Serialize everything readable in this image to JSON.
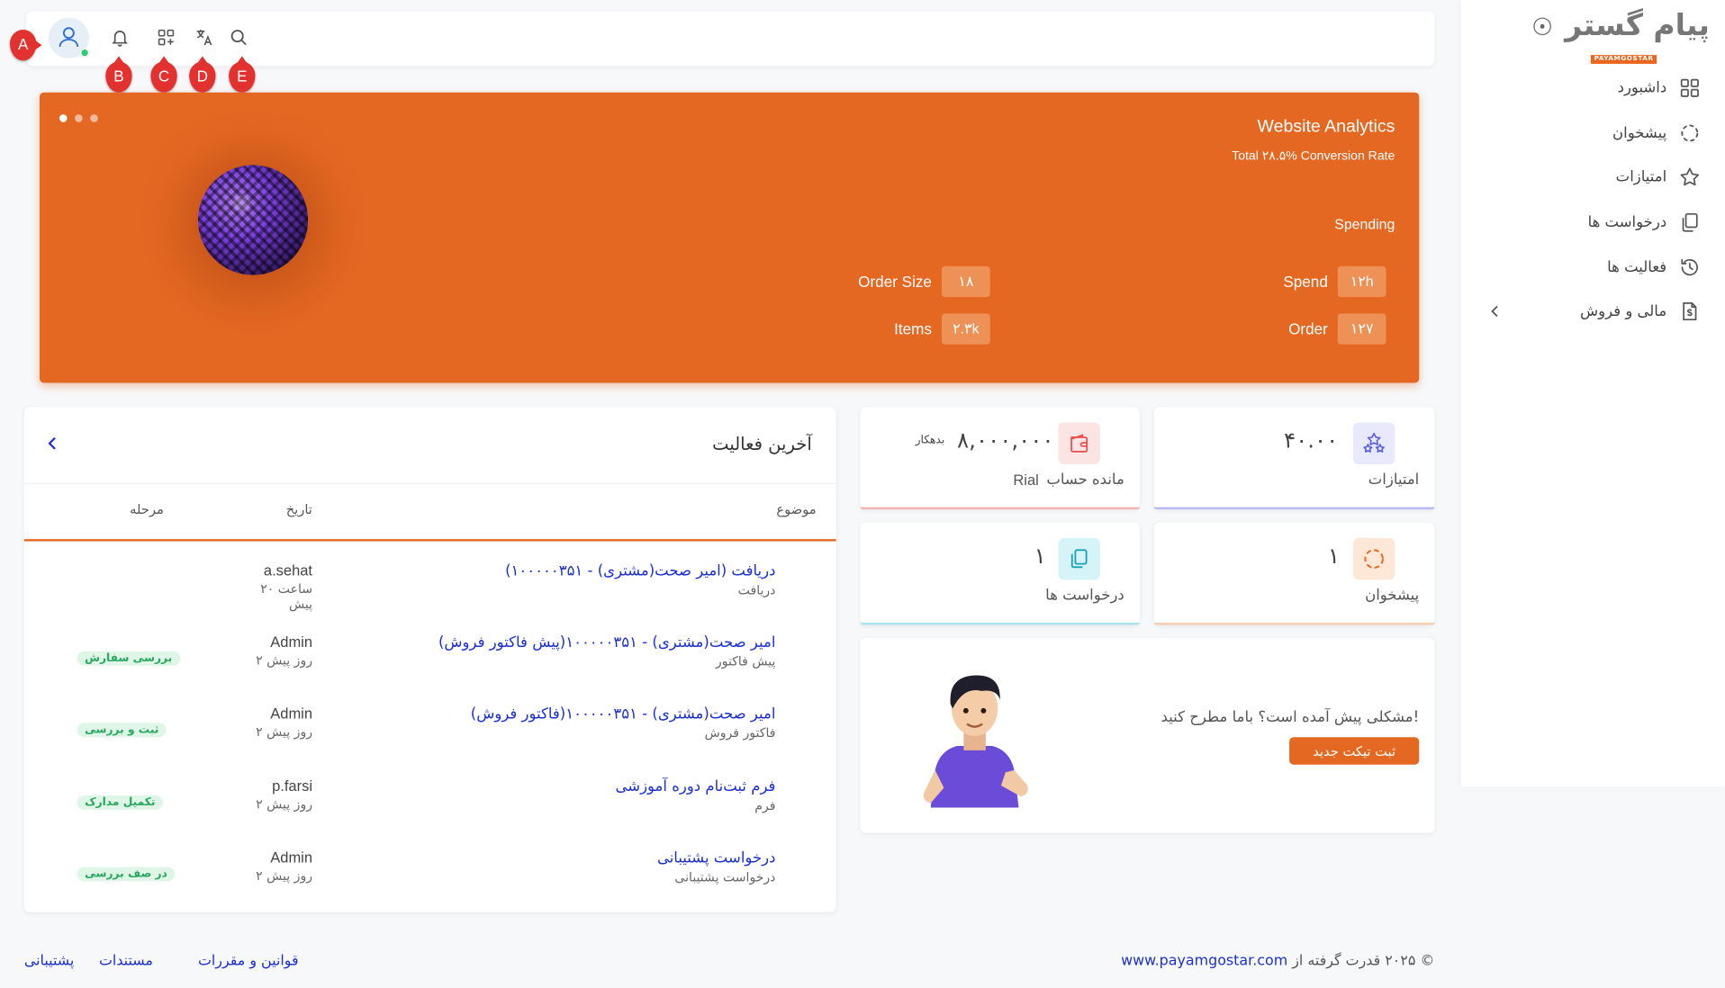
{
  "sidebar": {
    "brand": "پیام گستر",
    "brand_sub": "PAYAMGOSTAR",
    "items": [
      {
        "label": "داشبورد",
        "icon": "grid-icon"
      },
      {
        "label": "پیشخوان",
        "icon": "dashed-circle-icon"
      },
      {
        "label": "امتیازات",
        "icon": "star-icon"
      },
      {
        "label": "درخواست ها",
        "icon": "copy-icon"
      },
      {
        "label": "فعالیت ها",
        "icon": "history-icon"
      },
      {
        "label": "مالی و فروش",
        "icon": "invoice-icon"
      }
    ]
  },
  "topbar": {
    "markers": [
      "A",
      "B",
      "C",
      "D",
      "E"
    ],
    "icons": [
      "user-icon",
      "bell-icon",
      "apps-icon",
      "translate-icon",
      "search-icon"
    ]
  },
  "banner": {
    "title": "Website Analytics",
    "subtitle": "Total ۲۸.۵% Conversion Rate",
    "section": "Spending",
    "stats": [
      {
        "label": "Spend",
        "value": "۱۲h"
      },
      {
        "label": "Order",
        "value": "۱۲۷"
      },
      {
        "label": "Order Size",
        "value": "۱۸"
      },
      {
        "label": "Items",
        "value": "۲.۳k"
      }
    ]
  },
  "cards": {
    "points": {
      "value": "۴۰.۰۰",
      "label": "امتیازات"
    },
    "balance": {
      "value": "۸,۰۰۰,۰۰۰",
      "tag": "بدهکار",
      "label": "مانده حساب",
      "unit": "Rial"
    },
    "counter": {
      "value": "۱",
      "label": "پیشخوان"
    },
    "requests": {
      "value": "۱",
      "label": "درخواست ها"
    }
  },
  "help": {
    "text": "مشکلی پیش آمده است؟ باما مطرح کنید!",
    "button": "ثبت تیکت جدید"
  },
  "activity": {
    "title": "آخرین فعالیت",
    "columns": {
      "subject": "موضوع",
      "date": "تاریخ",
      "stage": "مرحله"
    },
    "rows": [
      {
        "subject": "دریافت (امیر صحت(مشتری) - ۱۰۰۰۰۰۳۵۱)",
        "category": "دریافت",
        "user": "a.sehat",
        "time": "۲۰ ساعت پیش",
        "stage": ""
      },
      {
        "subject": "امیر صحت(مشتری) - ۱۰۰۰۰۰۳۵۱(پیش فاکتور فروش)",
        "category": "پیش فاکتور",
        "user": "Admin",
        "time": "۲ روز پیش",
        "stage": "بررسی سفارش"
      },
      {
        "subject": "امیر صحت(مشتری) - ۱۰۰۰۰۰۳۵۱(فاکتور فروش)",
        "category": "فاکتور فروش",
        "user": "Admin",
        "time": "۲ روز پیش",
        "stage": "ثبت و بررسی"
      },
      {
        "subject": "فرم ثبت‌نام دوره آموزشی",
        "category": "فرم",
        "user": "p.farsi",
        "time": "۲ روز پیش",
        "stage": "تکمیل مدارک"
      },
      {
        "subject": "درخواست پشتیبانی",
        "category": "درخواست پشتیبانی",
        "user": "Admin",
        "time": "۲ روز پیش",
        "stage": "در صف بررسی"
      }
    ]
  },
  "footer": {
    "support": "پشتیبانی",
    "docs": "مستندات",
    "terms": "قوانین و مقررات",
    "copyright": "© ۲۰۲۵ قدرت گرفته از",
    "site": "www.payamgostar.com"
  },
  "colors": {
    "accent": "#e46822",
    "link": "#1c2fd6",
    "badge_bg": "#dff5e8",
    "badge_fg": "#27a85c"
  }
}
